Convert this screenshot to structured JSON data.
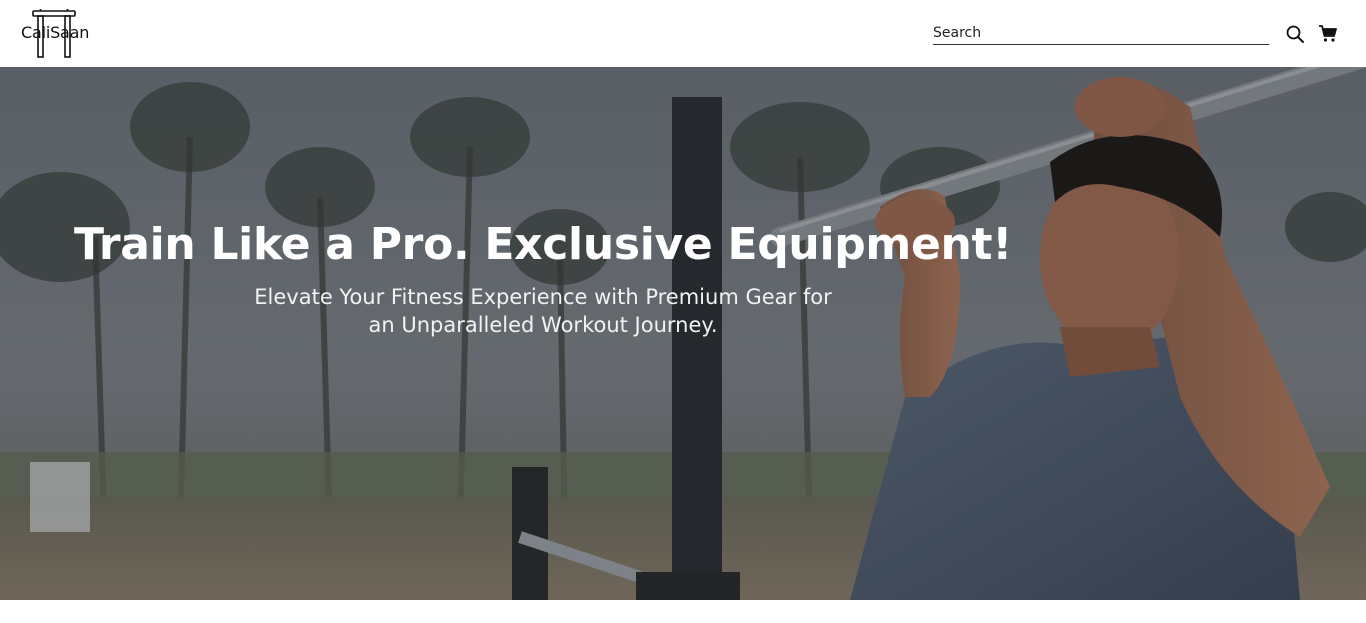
{
  "header": {
    "logo_text": "CaliSaan",
    "search": {
      "placeholder": "Search",
      "value": ""
    },
    "icons": {
      "search": "search-icon",
      "cart": "cart-icon"
    }
  },
  "hero": {
    "title": "Train Like a Pro. Exclusive Equipment!",
    "subtitle": "Elevate Your Fitness Experience with Premium Gear for an Unparalleled Workout Journey."
  },
  "colors": {
    "header_bg": "#ffffff",
    "hero_text": "#ffffff",
    "icon": "#111111"
  }
}
